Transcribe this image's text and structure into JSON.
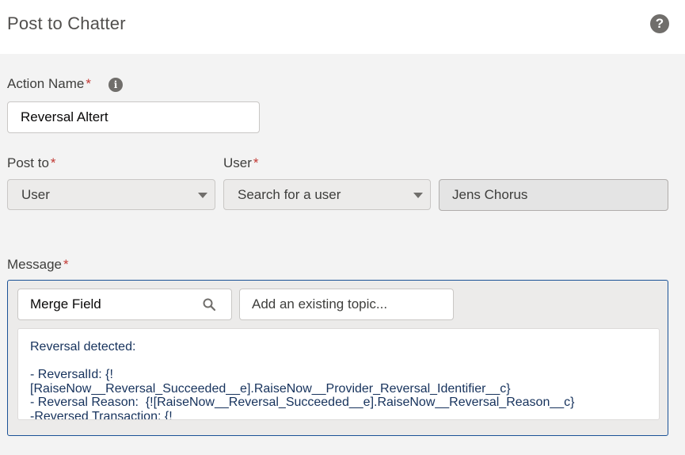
{
  "header": {
    "title": "Post to Chatter",
    "help_icon": "question-circle-icon"
  },
  "action_name": {
    "label": "Action Name",
    "required_mark": "*",
    "info_icon": "info-icon",
    "value": "Reversal Altert"
  },
  "post_to": {
    "label": "Post to",
    "required_mark": "*",
    "selected": "User"
  },
  "user": {
    "label": "User",
    "required_mark": "*",
    "search_placeholder": "Search for a user",
    "selected_user": "Jens Chorus"
  },
  "message": {
    "label": "Message",
    "required_mark": "*",
    "merge_field_label": "Merge Field",
    "topic_placeholder": "Add an existing topic...",
    "lines": [
      "Reversal detected:",
      "",
      "- ReversalId: {!",
      "[RaiseNow__Reversal_Succeeded__e].RaiseNow__Provider_Reversal_Identifier__c}",
      "- Reversal Reason:  {![RaiseNow__Reversal_Succeeded__e].RaiseNow__Reversal_Reason__c}",
      "-Reversed Transaction: {!"
    ]
  },
  "colors": {
    "required": "#c23934",
    "focus_border": "#1b5297",
    "message_text": "#16325c"
  }
}
